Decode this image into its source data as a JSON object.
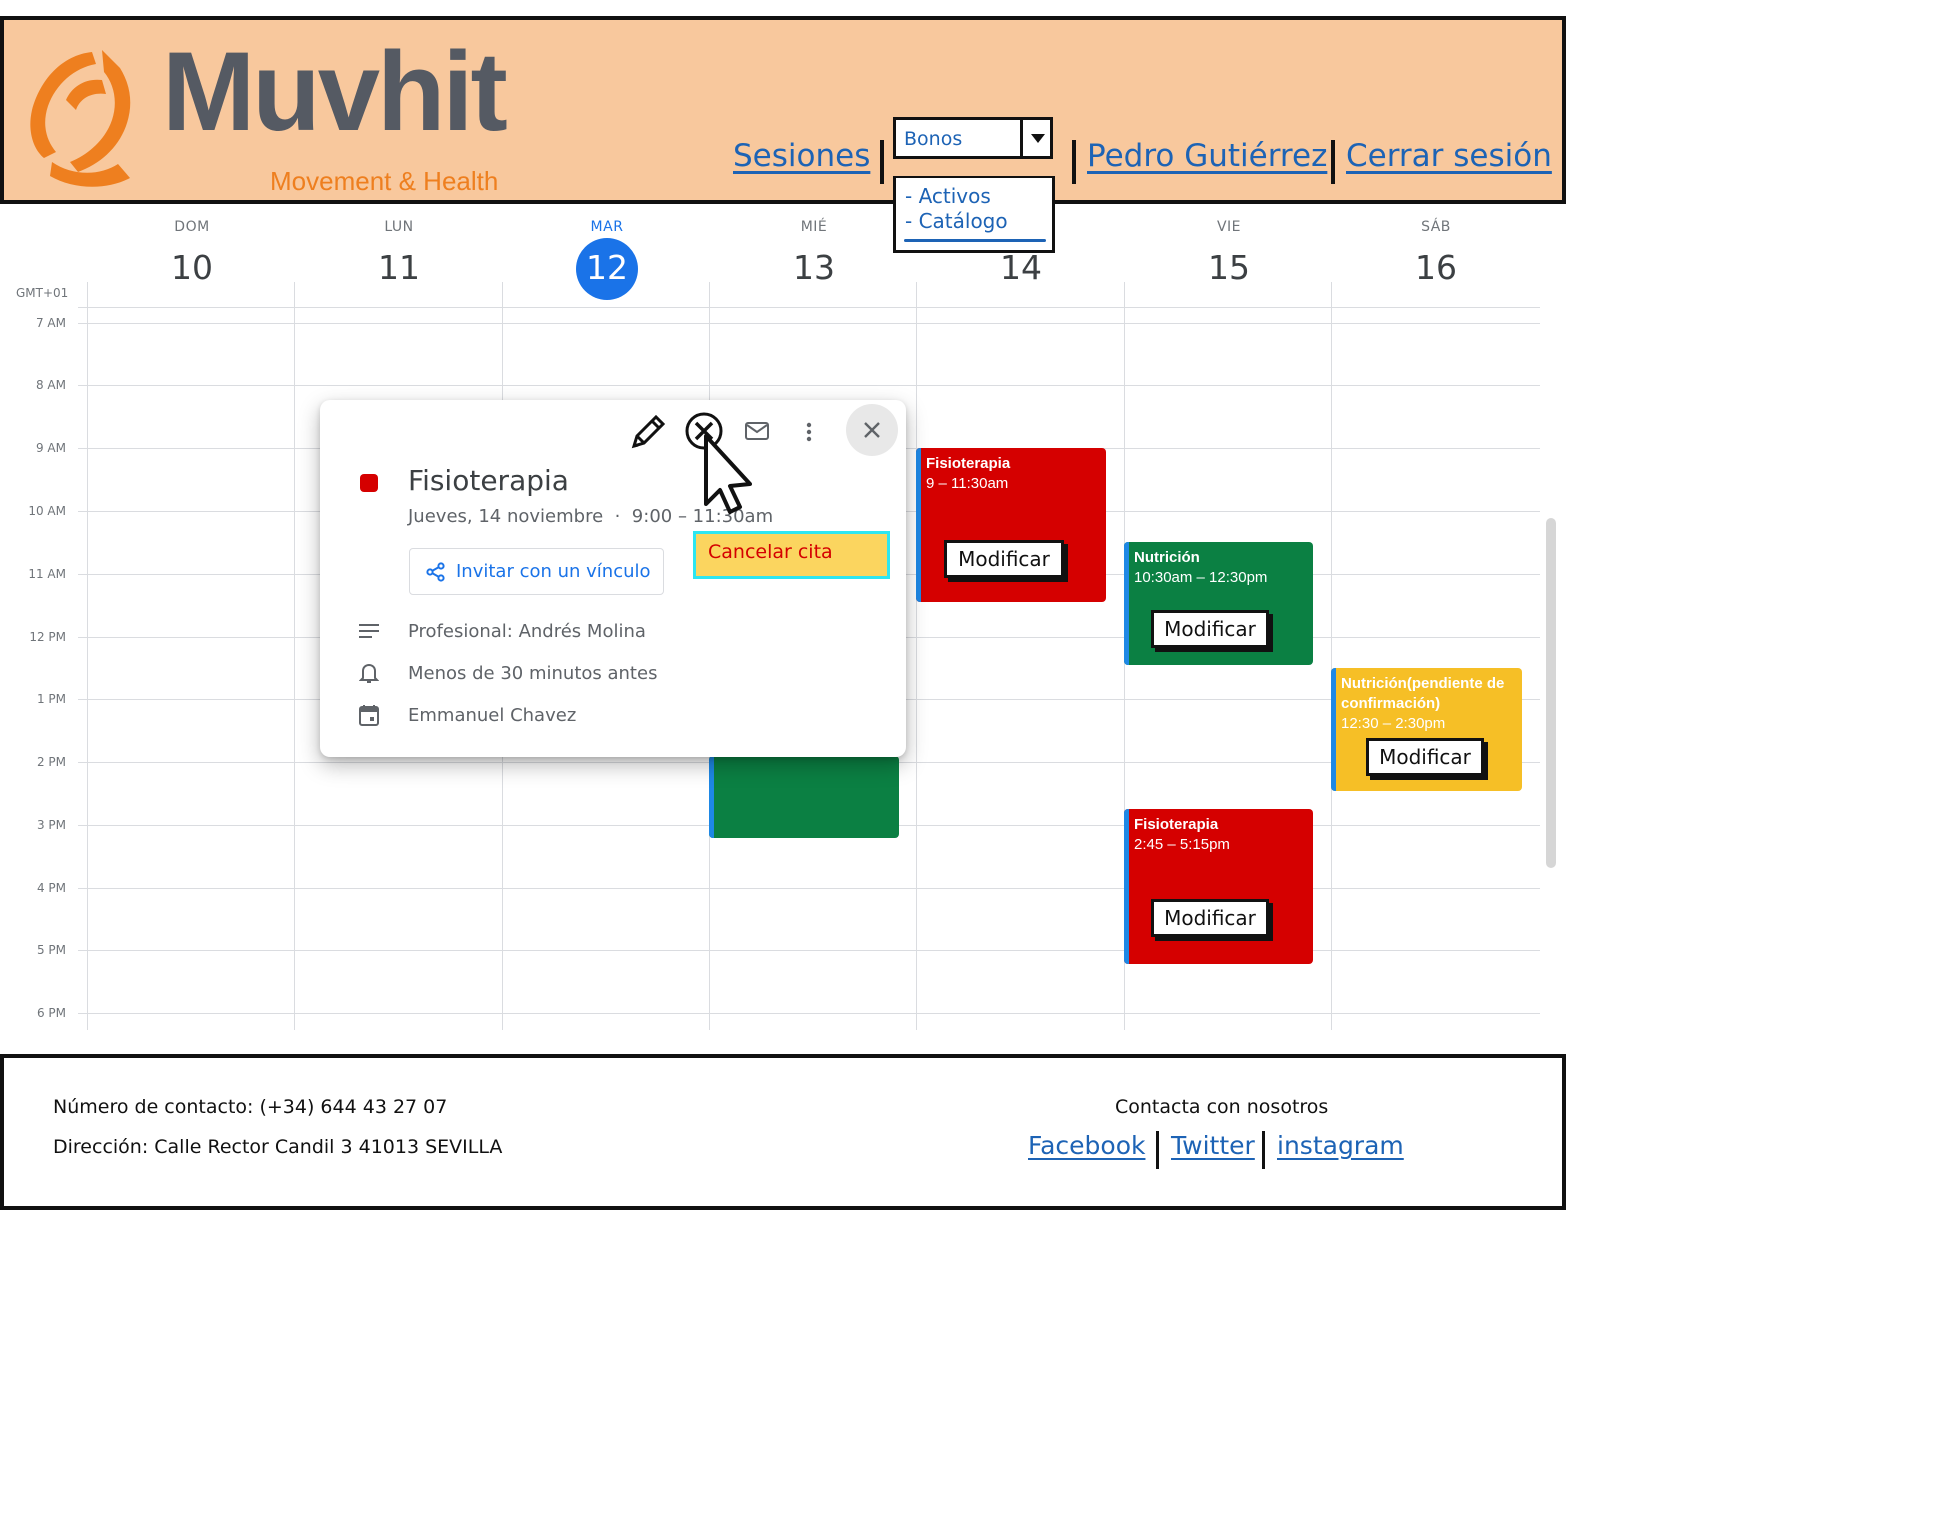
{
  "brand": {
    "name": "Muvhit",
    "tagline": "Movement & Health"
  },
  "nav": {
    "sesiones": "Sesiones",
    "bonos_select": {
      "value": "Bonos",
      "options": [
        "- Activos",
        "- Catálogo"
      ]
    },
    "user": "Pedro Gutiérrez",
    "logout": "Cerrar sesión"
  },
  "calendar": {
    "timezone": "GMT+01",
    "days": [
      {
        "dow": "DOM",
        "num": "10"
      },
      {
        "dow": "LUN",
        "num": "11"
      },
      {
        "dow": "MAR",
        "num": "12",
        "today": true
      },
      {
        "dow": "MIÉ",
        "num": "13"
      },
      {
        "dow": "JUE",
        "num": "14"
      },
      {
        "dow": "VIE",
        "num": "15"
      },
      {
        "dow": "SÁB",
        "num": "16"
      }
    ],
    "hours": [
      "7 AM",
      "8 AM",
      "9 AM",
      "10 AM",
      "11 AM",
      "12 PM",
      "1 PM",
      "2 PM",
      "3 PM",
      "4 PM",
      "5 PM",
      "6 PM"
    ],
    "events": [
      {
        "title": "Fisioterapia",
        "time": "9 – 11:30am",
        "day": "JUE",
        "color": "#d50000",
        "button": "Modificar"
      },
      {
        "title": "Nutrición",
        "time": "10:30am – 12:30pm",
        "day": "VIE",
        "color": "#0b8043",
        "button": "Modificar"
      },
      {
        "title": "Nutrición(pendiente de confirmación)",
        "time": "12:30 – 2:30pm",
        "day": "SÁB",
        "color": "#f6bf26",
        "button": "Modificar"
      },
      {
        "title": "Fisioterapia",
        "time": "2:45 – 5:15pm",
        "day": "VIE",
        "color": "#d50000",
        "button": "Modificar"
      },
      {
        "title": "",
        "time": "",
        "day": "MIÉ",
        "color": "#0b8043"
      }
    ]
  },
  "popup": {
    "title": "Fisioterapia",
    "color": "#d50000",
    "date": "Jueves, 14 noviembre",
    "time": "9:00 – 11:30am",
    "invite_label": "Invitar con un vínculo",
    "professional": "Profesional: Andrés Molina",
    "reminder": "Menos de 30 minutos antes",
    "calendar_owner": "Emmanuel Chavez",
    "tooltip": "Cancelar cita"
  },
  "footer": {
    "phone": "Número de contacto:  (+34) 644 43 27 07",
    "address": "Dirección: Calle Rector Candil 3 41013 SEVILLA",
    "contact_heading": "Contacta con nosotros",
    "links": [
      "Facebook",
      "Twitter",
      "instagram"
    ]
  },
  "colors": {
    "header_bg": "#f8c89d",
    "link": "#1d63b5",
    "today": "#1a73e8",
    "tooltip_bg": "#fbd55f",
    "tooltip_border": "#2ee6f0"
  }
}
